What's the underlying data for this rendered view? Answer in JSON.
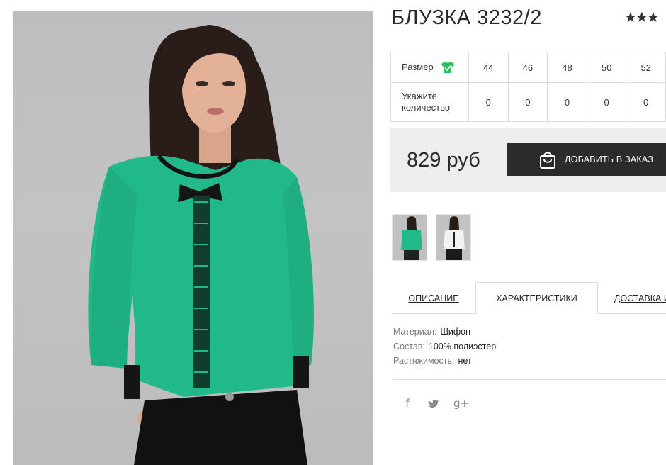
{
  "product": {
    "title": "БЛУЗКА 3232/2",
    "rating": "★★★",
    "price": "829 руб",
    "add_button": "ДОБАВИТЬ В ЗАКАЗ"
  },
  "size_table": {
    "size_label": "Размер",
    "qty_label": "Укажите количество",
    "sizes": [
      "44",
      "46",
      "48",
      "50",
      "52"
    ],
    "quantities": [
      "0",
      "0",
      "0",
      "0",
      "0"
    ]
  },
  "tabs": {
    "description": "ОПИСАНИЕ",
    "characteristics": "ХАРАКТЕРИСТИКИ",
    "delivery": "ДОСТАВКА И"
  },
  "specs": [
    {
      "key": "Материал:",
      "value": "Шифон"
    },
    {
      "key": "Состав:",
      "value": "100% полиэстер"
    },
    {
      "key": "Растяжимость:",
      "value": "нет"
    }
  ],
  "social": {
    "facebook": "f",
    "twitter": "twitter-icon",
    "gplus": "g+"
  },
  "colors": {
    "blouse_green": "#22b98a",
    "dark_button": "#2b2b2b",
    "check_green": "#2bbf5a"
  }
}
